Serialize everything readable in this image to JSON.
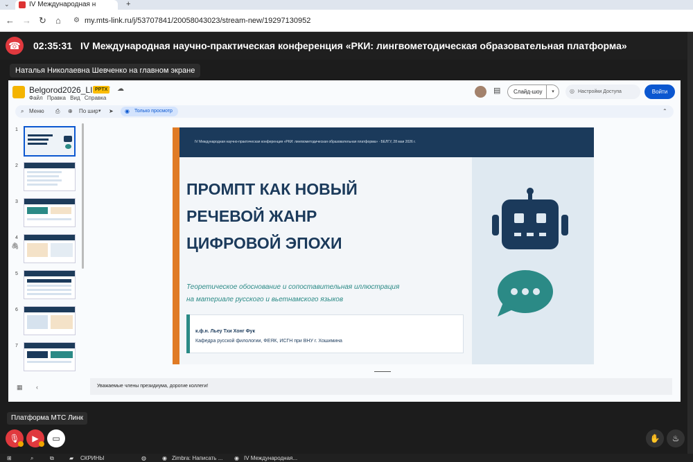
{
  "browser": {
    "tab_title": "IV Международная н",
    "url": "my.mts-link.ru/j/53707841/20058043023/stream-new/19297130952"
  },
  "meeting": {
    "timer": "02:35:31",
    "title": "IV Международная научно-практическая конференция «РКИ: лингвометодическая образовательная платформа»",
    "speaker_label": "Наталья Николаевна Шевченко на главном экране",
    "platform_label": "Платформа МТС Линк"
  },
  "app": {
    "doc_title": "Belgorod2026_LIGHT",
    "badge": "PPTX",
    "menu": [
      "Файл",
      "Правка",
      "Вид",
      "Справка"
    ],
    "slideshow_label": "Слайд-шоу",
    "access_label": "Настройки Доступа",
    "signin_label": "Войти",
    "toolbar": {
      "menu_label": "Меню",
      "zoom_label": "По шир",
      "viewonly_label": "Только просмотр"
    },
    "thumbnail_numbers": [
      "1",
      "2",
      "3",
      "4",
      "5",
      "6",
      "7"
    ],
    "notes_text": "Уважаемые члены президиума, дорогие коллеги!"
  },
  "slide": {
    "header": "IV Международная научно-практическая конференция «РКИ: лингвометодическая образовательная платформа»  ·  БЕЛГУ, 28 мая 2026 г.",
    "title_lines": [
      "ПРОМПТ КАК НОВЫЙ",
      "РЕЧЕВОЙ ЖАНР",
      "ЦИФРОВОЙ ЭПОХИ"
    ],
    "subtitle_lines": [
      "Теоретическое обоснование и сопоставительная иллюстрация",
      "на материале русского и вьетнамского языков"
    ],
    "author": "к.ф.н. Льеу Тхи Хонг Фук",
    "affiliation": "Кафедра русской филологии, ФЕЯК, ИСГН при ВНУ г. Хошимина",
    "icons": [
      "robot-icon",
      "chat-bubble-icon"
    ]
  },
  "taskbar": {
    "items": [
      "СКРИНЫ",
      "Zimbra: Написать ...",
      "IV Международная..."
    ]
  },
  "colors": {
    "accent_orange": "#e07b25",
    "navy": "#1b3a5b",
    "teal": "#2b8a86",
    "end_call_red": "#e0393e",
    "signin_blue": "#0b57d0"
  }
}
